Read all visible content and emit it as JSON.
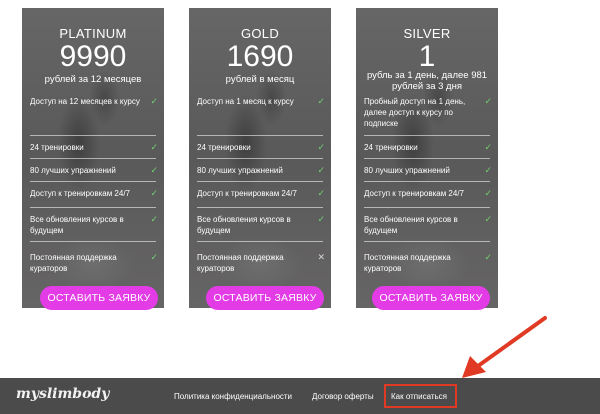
{
  "plans": [
    {
      "name": "PLATINUM",
      "price": "9990",
      "period": "рублей за 12 месяцев",
      "button": "ОСТАВИТЬ ЗАЯВКУ",
      "features": [
        {
          "text": "Доступ на 12 месяцев к курсу",
          "mark": "check"
        },
        {
          "text": "24 тренировки",
          "mark": "check"
        },
        {
          "text": "80 лучших упражнений",
          "mark": "check"
        },
        {
          "text": "Доступ к тренировкам 24/7",
          "mark": "check"
        },
        {
          "text": "Все обновления курсов в будущем",
          "mark": "check"
        },
        {
          "text": "Постоянная поддержка кураторов",
          "mark": "check"
        }
      ]
    },
    {
      "name": "GOLD",
      "price": "1690",
      "period": "рублей в месяц",
      "button": "ОСТАВИТЬ ЗАЯВКУ",
      "features": [
        {
          "text": "Доступ на 1 месяц к курсу",
          "mark": "check"
        },
        {
          "text": "24 тренировки",
          "mark": "check"
        },
        {
          "text": "80 лучших упражнений",
          "mark": "check"
        },
        {
          "text": "Доступ к тренировкам 24/7",
          "mark": "check"
        },
        {
          "text": "Все обновления курсов в будущем",
          "mark": "check"
        },
        {
          "text": "Постоянная поддержка кураторов",
          "mark": "cross"
        }
      ]
    },
    {
      "name": "SILVER",
      "price": "1",
      "period": "рубль за 1 день, далее 981 рублей за 3 дня",
      "button": "ОСТАВИТЬ ЗАЯВКУ",
      "features": [
        {
          "text": "Пробный доступ на 1 день, далее доступ к курсу по подписке",
          "mark": "check"
        },
        {
          "text": "24 тренировки",
          "mark": "check"
        },
        {
          "text": "80 лучших упражнений",
          "mark": "check"
        },
        {
          "text": "Доступ к тренировкам 24/7",
          "mark": "check"
        },
        {
          "text": "Все обновления курсов в будущем",
          "mark": "check"
        },
        {
          "text": "Постоянная поддержка кураторов",
          "mark": "check"
        }
      ]
    }
  ],
  "marks": {
    "check": "✓",
    "cross": "✕"
  },
  "footer": {
    "logo": "myslimbody",
    "links": [
      "Политика конфиденциальности",
      "Договор оферты",
      "Как отписаться"
    ]
  },
  "colors": {
    "button": "#e33be6",
    "card": "#5d5c5c",
    "footer": "#4b4b4b",
    "highlight": "#e03a24",
    "check": "#6fd36f"
  }
}
